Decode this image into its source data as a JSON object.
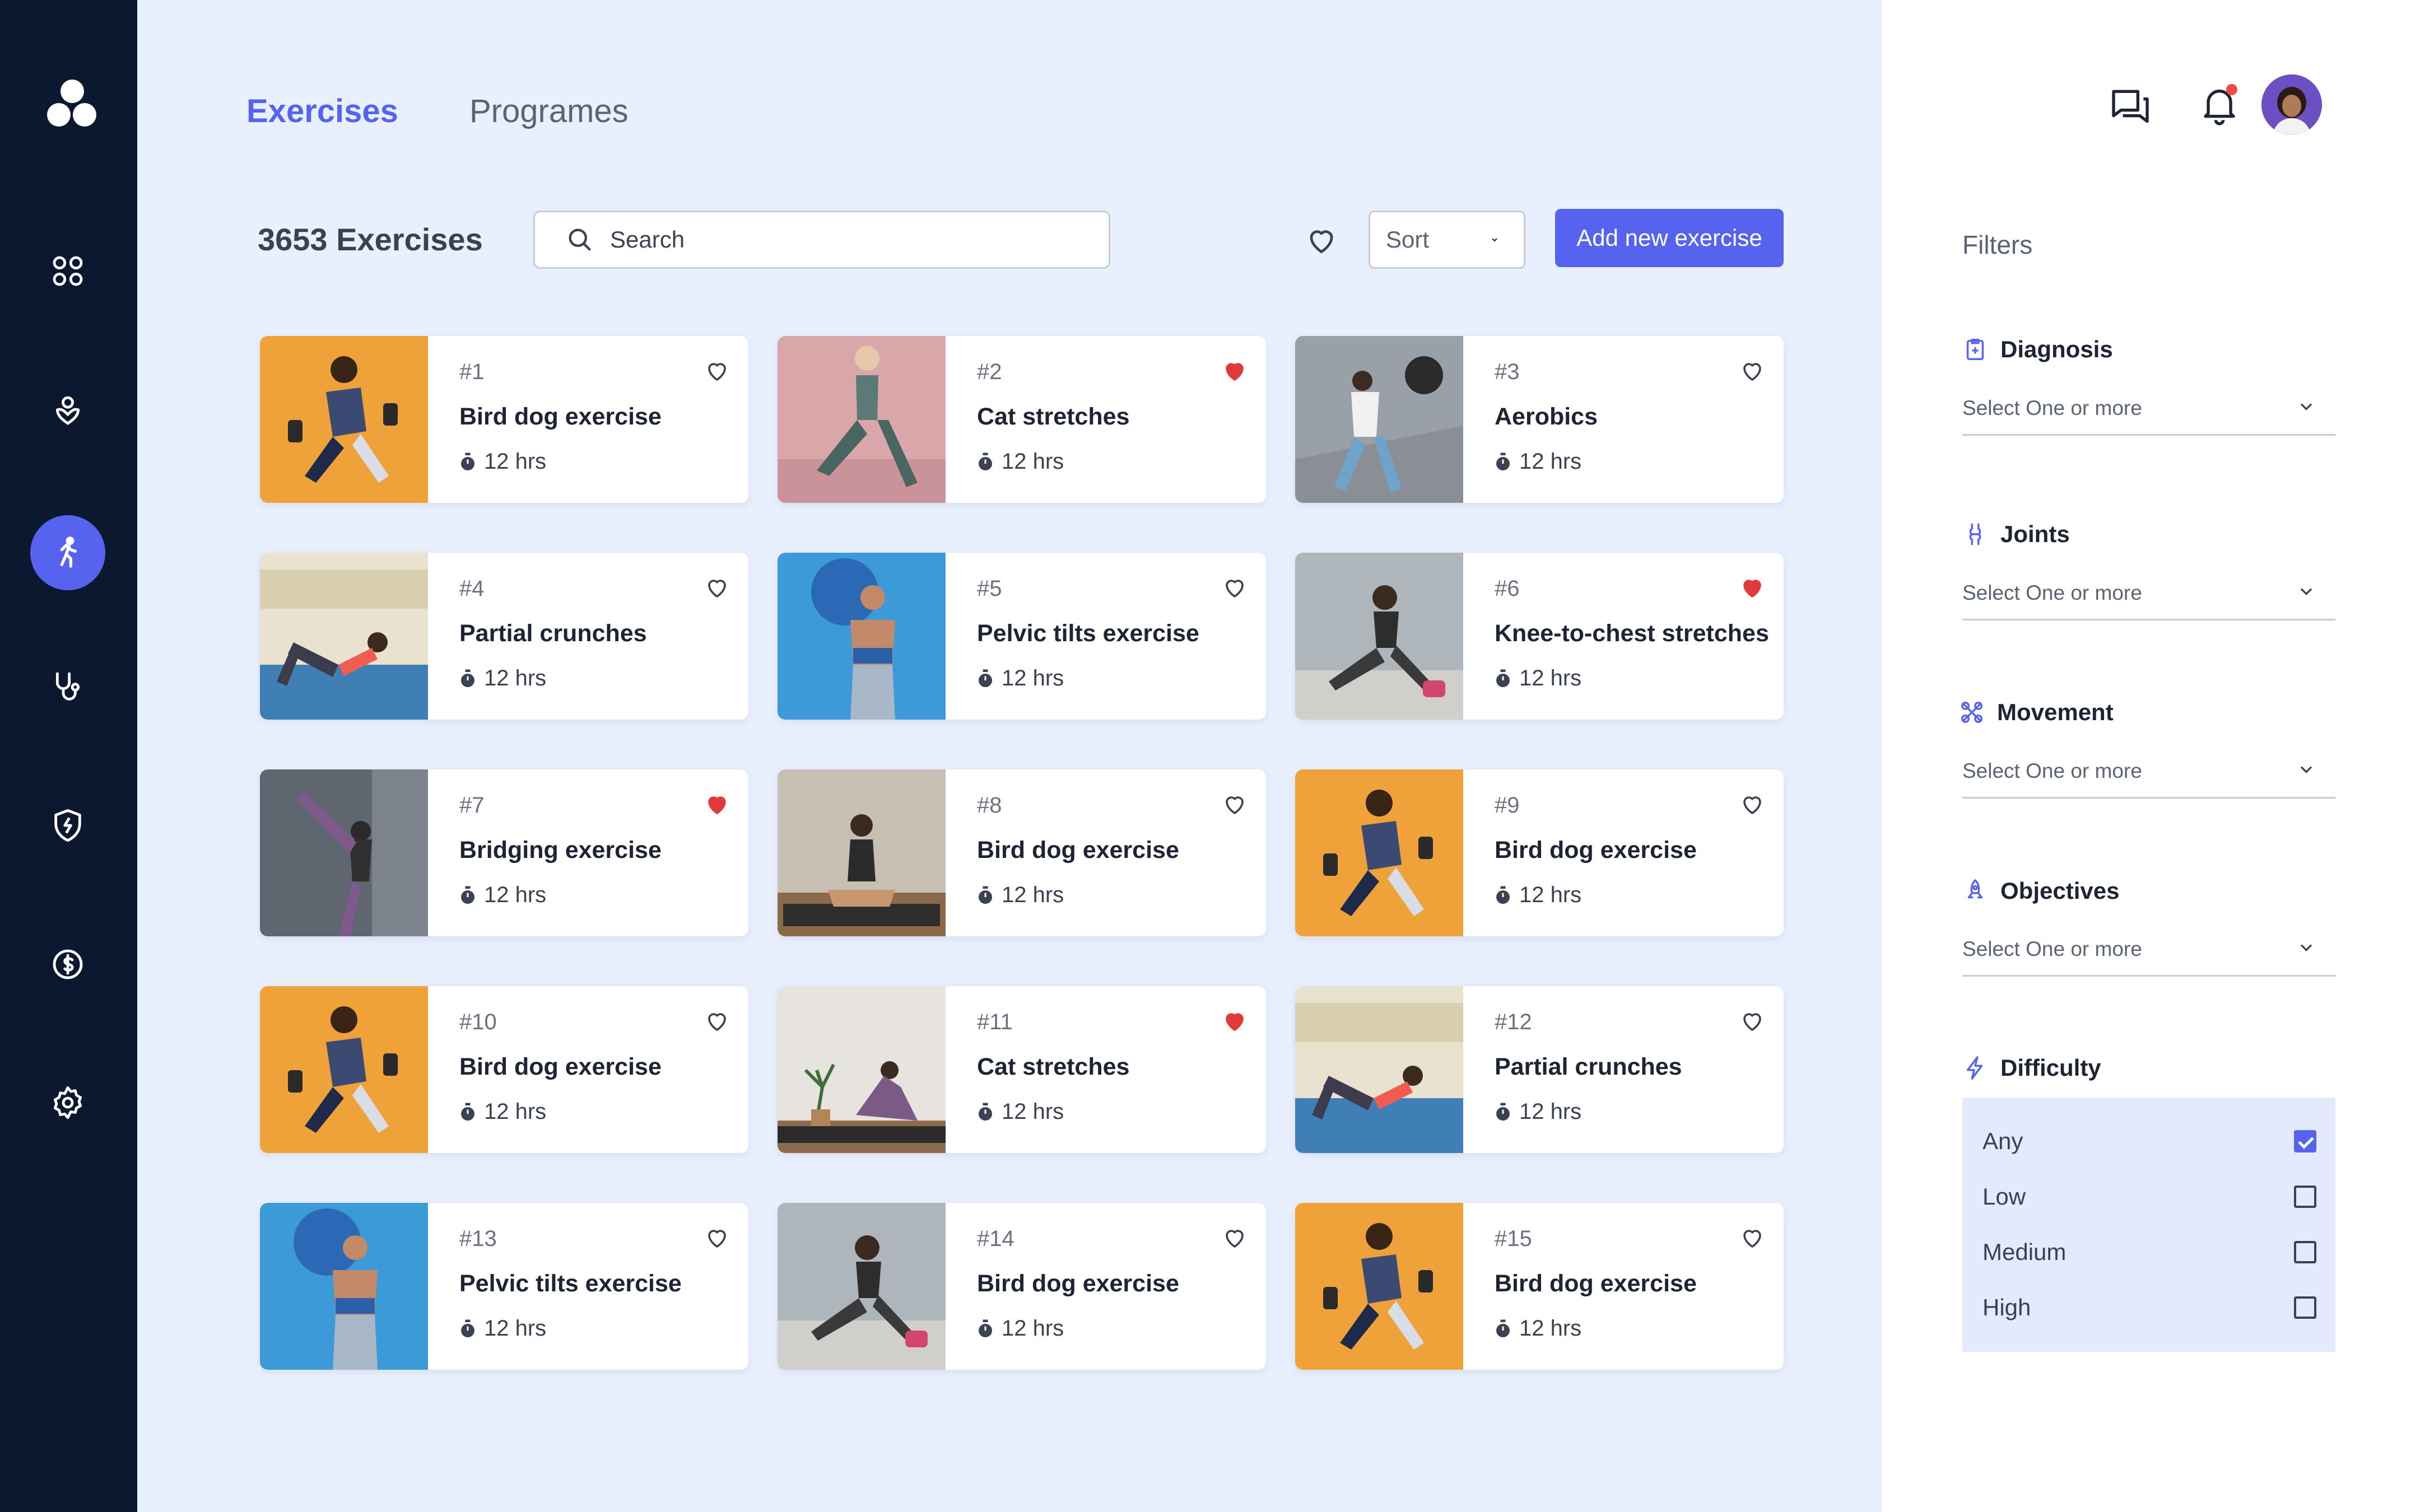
{
  "tabs": {
    "exercises": "Exercises",
    "programes": "Programes"
  },
  "toolbar": {
    "count": "3653 Exercises",
    "search_placeholder": "Search",
    "sort_label": "Sort",
    "add_label": "Add new exercise"
  },
  "exercises": [
    {
      "num": "#1",
      "title": "Bird dog exercise",
      "duration": "12 hrs",
      "liked": false,
      "photo": "orange-runner"
    },
    {
      "num": "#2",
      "title": "Cat stretches",
      "duration": "12 hrs",
      "liked": true,
      "photo": "pink-lunge"
    },
    {
      "num": "#3",
      "title": "Aerobics",
      "duration": "12 hrs",
      "liked": false,
      "photo": "wall-ball"
    },
    {
      "num": "#4",
      "title": "Partial crunches",
      "duration": "12 hrs",
      "liked": false,
      "photo": "mat-crunch"
    },
    {
      "num": "#5",
      "title": "Pelvic tilts exercise",
      "duration": "12 hrs",
      "liked": false,
      "photo": "blue-ball"
    },
    {
      "num": "#6",
      "title": "Knee-to-chest stretches",
      "duration": "12 hrs",
      "liked": true,
      "photo": "floor-stretch"
    },
    {
      "num": "#7",
      "title": "Bridging exercise",
      "duration": "12 hrs",
      "liked": true,
      "photo": "wall-kick"
    },
    {
      "num": "#8",
      "title": "Bird dog exercise",
      "duration": "12 hrs",
      "liked": false,
      "photo": "yoga-sit"
    },
    {
      "num": "#9",
      "title": "Bird dog exercise",
      "duration": "12 hrs",
      "liked": false,
      "photo": "orange-runner"
    },
    {
      "num": "#10",
      "title": "Bird dog exercise",
      "duration": "12 hrs",
      "liked": false,
      "photo": "orange-runner"
    },
    {
      "num": "#11",
      "title": "Cat stretches",
      "duration": "12 hrs",
      "liked": true,
      "photo": "plant-yoga"
    },
    {
      "num": "#12",
      "title": "Partial crunches",
      "duration": "12 hrs",
      "liked": false,
      "photo": "mat-crunch"
    },
    {
      "num": "#13",
      "title": "Pelvic tilts exercise",
      "duration": "12 hrs",
      "liked": false,
      "photo": "blue-ball"
    },
    {
      "num": "#14",
      "title": "Bird dog exercise",
      "duration": "12 hrs",
      "liked": false,
      "photo": "floor-stretch"
    },
    {
      "num": "#15",
      "title": "Bird dog exercise",
      "duration": "12 hrs",
      "liked": false,
      "photo": "orange-runner"
    }
  ],
  "filters": {
    "title": "Filters",
    "diagnosis": {
      "label": "Diagnosis",
      "value": "Select One or more",
      "icon": "clipboard-plus-icon"
    },
    "joints": {
      "label": "Joints",
      "value": "Select One or more",
      "icon": "joint-icon"
    },
    "movement": {
      "label": "Movement",
      "value": "Select One or more",
      "icon": "movement-icon"
    },
    "objectives": {
      "label": "Objectives",
      "value": "Select One or more",
      "icon": "rocket-icon"
    },
    "difficulty": {
      "label": "Difficulty",
      "icon": "lightning-icon",
      "options": [
        {
          "label": "Any",
          "checked": true
        },
        {
          "label": "Low",
          "checked": false
        },
        {
          "label": "Medium",
          "checked": false
        },
        {
          "label": "High",
          "checked": false
        }
      ]
    }
  },
  "colors": {
    "accent": "#5563ef",
    "sidebar": "#0c1730",
    "background": "#e8effd",
    "heart": "#e03a3a"
  }
}
